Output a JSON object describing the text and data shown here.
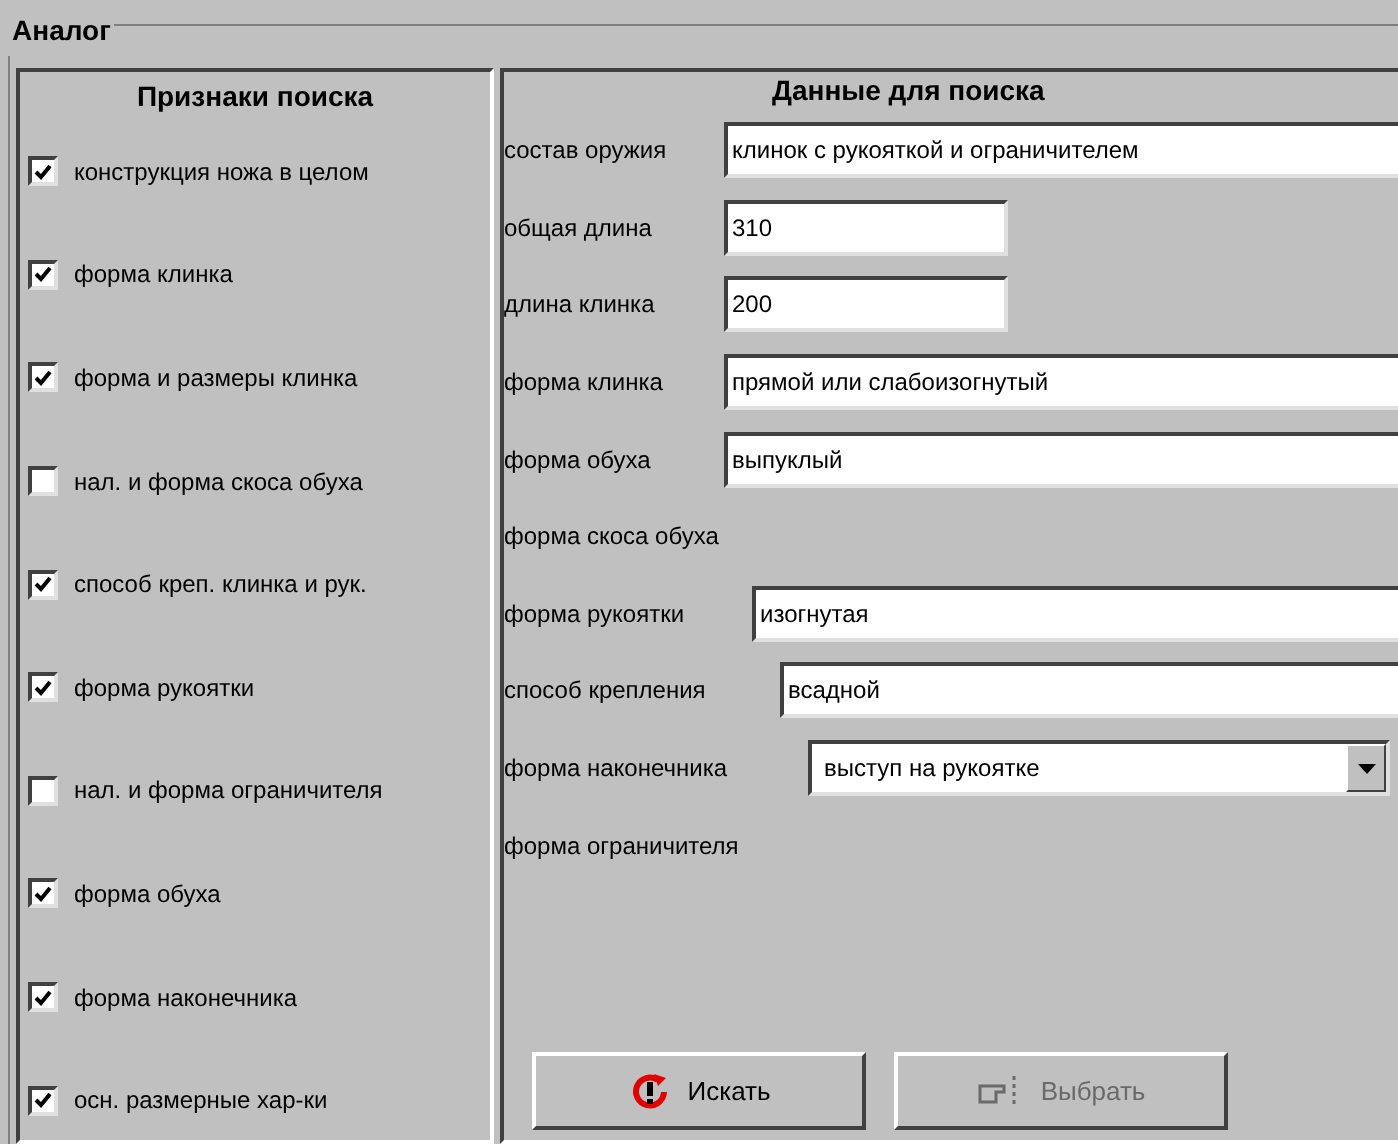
{
  "group_title": "Аналог",
  "criteria": {
    "title": "Признаки поиска",
    "items": [
      {
        "label": "конструкция ножа в целом",
        "checked": true
      },
      {
        "label": "форма клинка",
        "checked": true
      },
      {
        "label": "форма и размеры клинка",
        "checked": true
      },
      {
        "label": "нал. и форма скоса обуха",
        "checked": false
      },
      {
        "label": "способ креп. клинка и рук.",
        "checked": true
      },
      {
        "label": "форма рукоятки",
        "checked": true
      },
      {
        "label": "нал. и форма ограничителя",
        "checked": false
      },
      {
        "label": "форма обуха",
        "checked": true
      },
      {
        "label": "форма наконечника",
        "checked": true
      },
      {
        "label": "осн. размерные хар-ки",
        "checked": true
      }
    ]
  },
  "search_data": {
    "title": "Данные для поиска",
    "fields": [
      {
        "kind": "text",
        "label": "состав оружия",
        "value": "клинок с рукояткой и ограничителем"
      },
      {
        "kind": "short",
        "label": "общая длина",
        "value": "310"
      },
      {
        "kind": "short",
        "label": "длина клинка",
        "value": "200"
      },
      {
        "kind": "text",
        "label": "форма клинка",
        "value": "прямой или слабоизогнутый"
      },
      {
        "kind": "text",
        "label": "форма обуха",
        "value": "выпуклый"
      },
      {
        "kind": "label",
        "label": "форма скоса обуха"
      },
      {
        "kind": "text",
        "label": "форма рукоятки",
        "value": "изогнутая"
      },
      {
        "kind": "text",
        "label": "способ крепления",
        "value": "всадной"
      },
      {
        "kind": "select",
        "label": "форма наконечника",
        "value": "выступ на рукоятке"
      },
      {
        "kind": "label",
        "label": "форма ограничителя"
      }
    ]
  },
  "buttons": [
    {
      "kind": "search",
      "label": "Искать",
      "disabled": false
    },
    {
      "kind": "select",
      "label": "Выбрать",
      "disabled": true
    }
  ]
}
